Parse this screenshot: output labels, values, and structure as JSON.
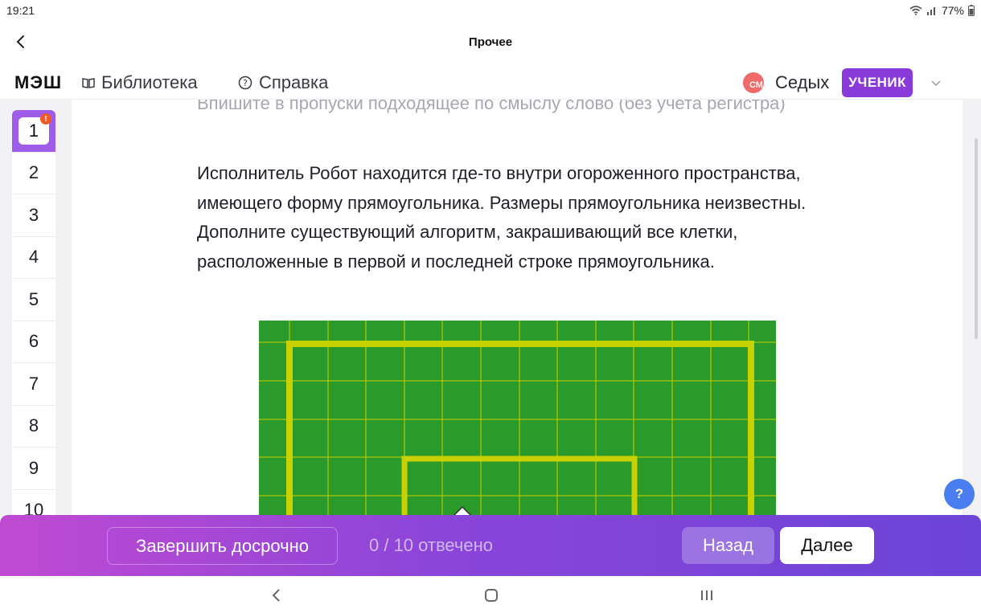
{
  "status": {
    "time": "19:21",
    "battery": "77%"
  },
  "titlebar": {
    "title": "Прочее",
    "back_icon": "chevron-left-icon"
  },
  "header": {
    "logo": "МЭШ",
    "library": "Библиотека",
    "help": "Справка",
    "user_name": "Седых",
    "avatar_initials": "СМ",
    "role": "УЧЕНИК"
  },
  "question_nav": {
    "items": [
      "1",
      "2",
      "3",
      "4",
      "5",
      "6",
      "7",
      "8",
      "9",
      "10"
    ],
    "active": 0,
    "warning": "!"
  },
  "content": {
    "instruction": "Впишите в пропуски подходящее по смыслу слово (без учета регистра)",
    "task": "Исполнитель Робот находится где-то внутри огороженного пространства, имеющего форму прямоугольника. Размеры прямоугольника неизвестны. Дополните существующий алгоритм, закрашивающий все клетки, расположенные в первой и последней строке прямоугольника."
  },
  "help_button": "?",
  "footer": {
    "finish": "Завершить досрочно",
    "progress": "0 / 10 отвечено",
    "back": "Назад",
    "next": "Далее"
  },
  "colors": {
    "accent": "#8a3ad8",
    "field_green": "#2a9a2a",
    "wall_yellow": "#c8d200",
    "help_blue": "#4a7ef0"
  }
}
